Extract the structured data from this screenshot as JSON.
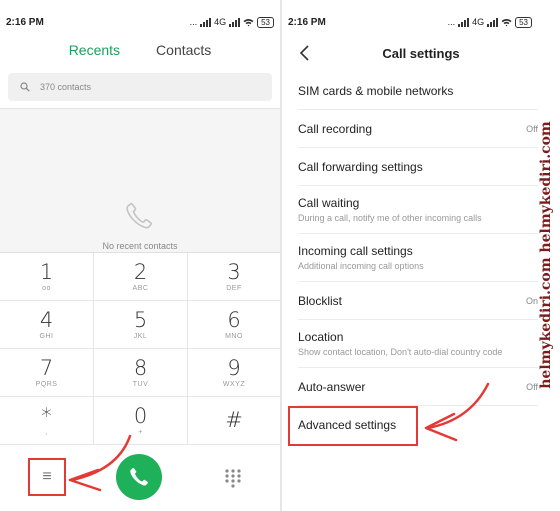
{
  "status": {
    "time": "2:16 PM",
    "signal_text": "...",
    "network": "4G",
    "battery": "53"
  },
  "dialer": {
    "tabs": {
      "recents": "Recents",
      "contacts": "Contacts"
    },
    "search_placeholder": "370 contacts",
    "empty_text": "No recent contacts",
    "keys": [
      {
        "digit": "1",
        "letters": "ᴏᴏ"
      },
      {
        "digit": "2",
        "letters": "ABC"
      },
      {
        "digit": "3",
        "letters": "DEF"
      },
      {
        "digit": "4",
        "letters": "GHI"
      },
      {
        "digit": "5",
        "letters": "JKL"
      },
      {
        "digit": "6",
        "letters": "MNO"
      },
      {
        "digit": "7",
        "letters": "PQRS"
      },
      {
        "digit": "8",
        "letters": "TUV"
      },
      {
        "digit": "9",
        "letters": "WXYZ"
      },
      {
        "digit": "*",
        "letters": ","
      },
      {
        "digit": "0",
        "letters": "+"
      },
      {
        "digit": "#",
        "letters": ""
      }
    ],
    "menu_glyph": "≡",
    "accent": "#1fb15a"
  },
  "settings": {
    "title": "Call settings",
    "rows": [
      {
        "title": "SIM cards & mobile networks",
        "sub": "",
        "value": ""
      },
      {
        "title": "Call recording",
        "sub": "",
        "value": "Off"
      },
      {
        "title": "Call forwarding settings",
        "sub": "",
        "value": ""
      },
      {
        "title": "Call waiting",
        "sub": "During a call, notify me of other incoming calls",
        "value": ""
      },
      {
        "title": "Incoming call settings",
        "sub": "Additional incoming call options",
        "value": ""
      },
      {
        "title": "Blocklist",
        "sub": "",
        "value": "On"
      },
      {
        "title": "Location",
        "sub": "Show contact location, Don't auto-dial country code",
        "value": ""
      },
      {
        "title": "Auto-answer",
        "sub": "",
        "value": "Off"
      },
      {
        "title": "Advanced settings",
        "sub": "",
        "value": ""
      }
    ]
  },
  "watermark": "helmykediri.com helmykediri.com",
  "highlight_color": "#e53935"
}
